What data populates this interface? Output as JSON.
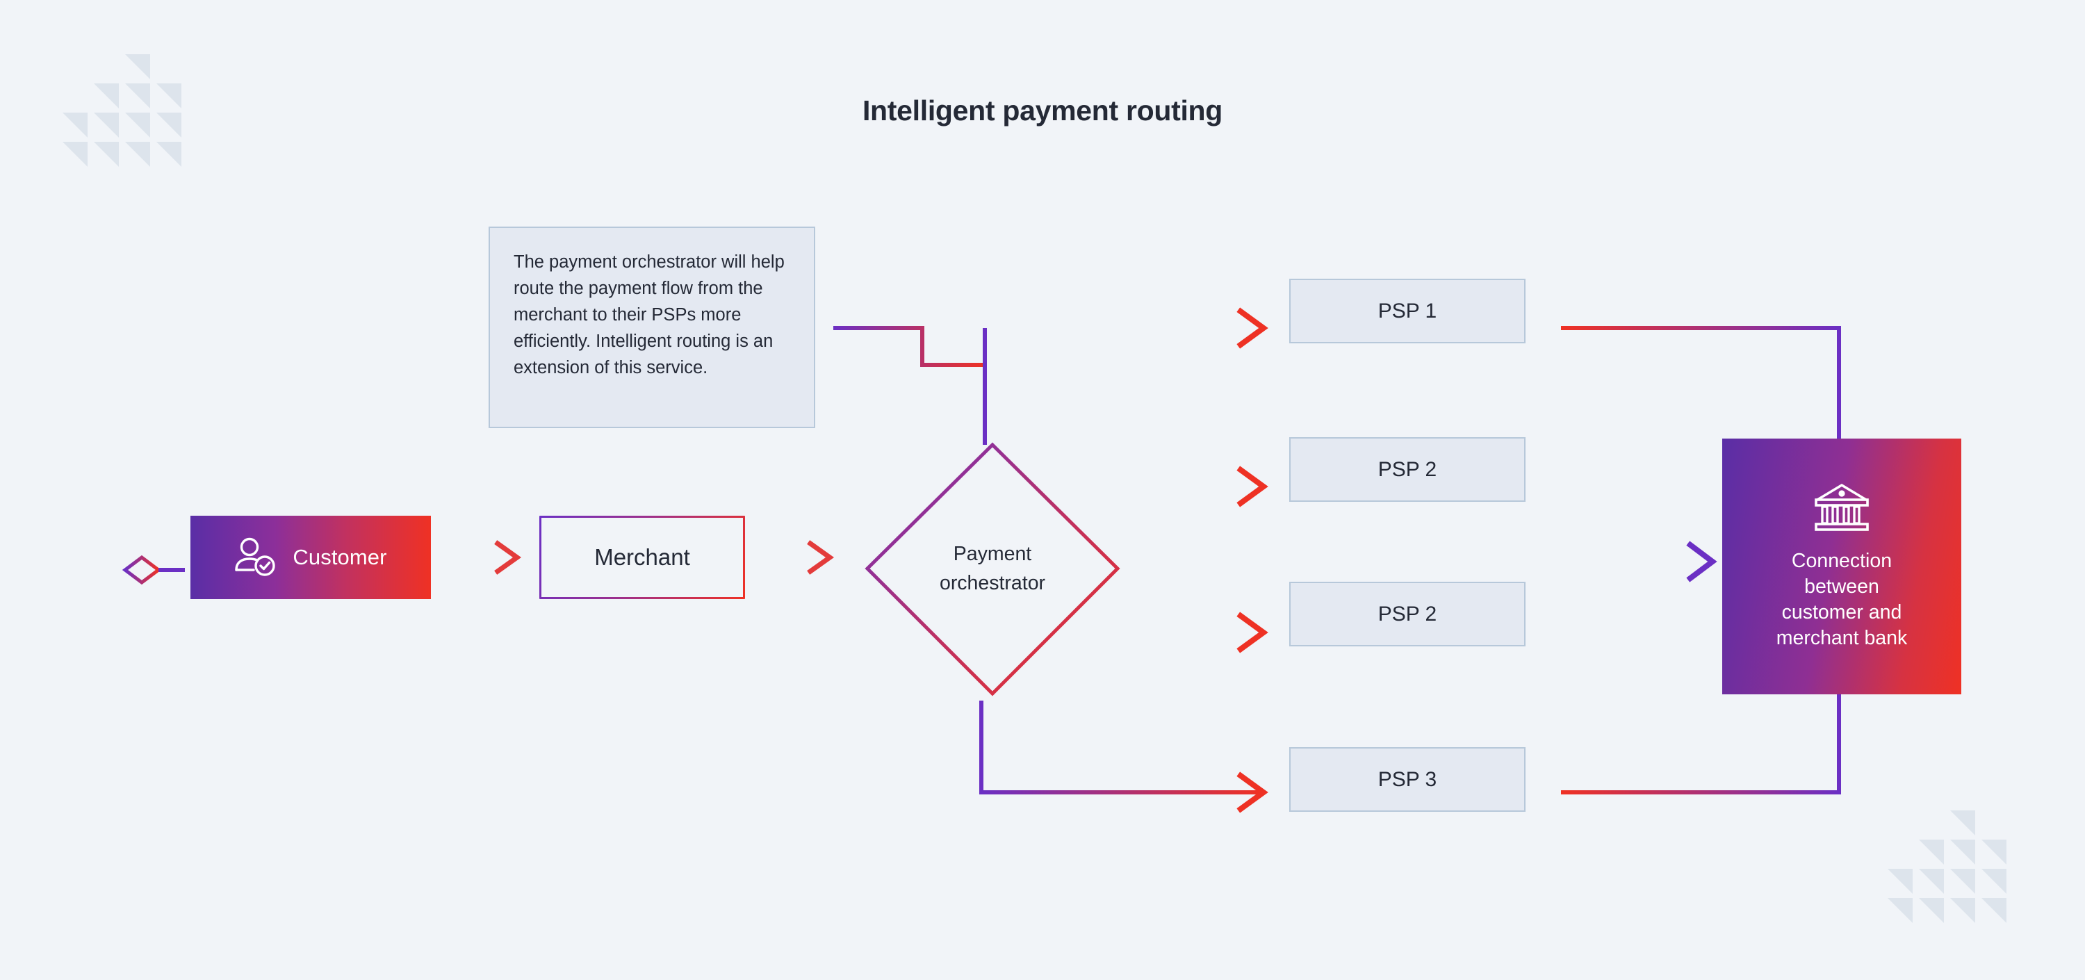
{
  "diagram": {
    "title": "Intelligent payment routing",
    "background_color": "#f1f4f8",
    "accent_purple": "#6b2fc4",
    "accent_red": "#ef3124",
    "node_fill": "#e4e9f2",
    "node_border": "#b7c8da",
    "text_color": "#242936"
  },
  "note": {
    "text": "The payment orchestrator will help route the payment flow from the merchant to their PSPs more efficiently. Intelligent routing is an extension of this service."
  },
  "customer": {
    "label": "Customer",
    "icon": "user-check-icon"
  },
  "merchant": {
    "label": "Merchant"
  },
  "orchestrator": {
    "line1": "Payment",
    "line2": "orchestrator"
  },
  "psps": [
    {
      "label": "PSP 1"
    },
    {
      "label": "PSP 2"
    },
    {
      "label": "PSP 2"
    },
    {
      "label": "PSP 3"
    }
  ],
  "bank": {
    "icon": "bank-icon",
    "line1": "Connection",
    "line2": "between",
    "line3": "customer and",
    "line4": "merchant bank"
  },
  "decoration": {
    "triangle_color": "#dde4ec",
    "top_left": "triangle-stair-pattern",
    "bottom_right": "triangle-stair-pattern"
  }
}
